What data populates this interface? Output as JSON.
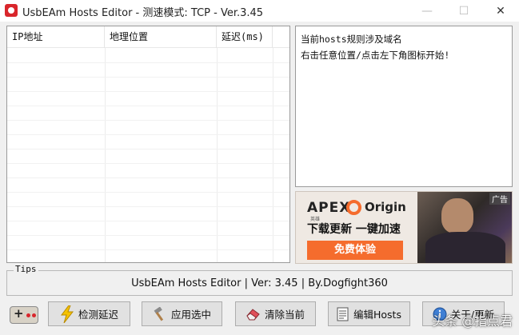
{
  "window": {
    "title": "UsbEAm Hosts Editor - 测速模式: TCP - Ver.3.45",
    "minimize_glyph": "—",
    "maximize_glyph": "☐",
    "close_glyph": "✕"
  },
  "table": {
    "columns": [
      "IP地址",
      "地理位置",
      "延迟(ms)",
      ""
    ],
    "rows": []
  },
  "info": {
    "lines": [
      "当前hosts规则涉及域名",
      "右击任意位置/点击左下角图标开始!"
    ]
  },
  "ad": {
    "tag": "广告",
    "brand": "APEX",
    "brand_sub": "英雄",
    "partner": "Origin",
    "headline": "下载更新 一键加速",
    "cta": "免费体验"
  },
  "tips": {
    "label": "Tips",
    "text": "UsbEAm Hosts Editor | Ver: 3.45 | By.Dogfight360"
  },
  "toolbar": {
    "buttons": [
      {
        "label": "检测延迟",
        "icon": "lightning-icon"
      },
      {
        "label": "应用选中",
        "icon": "hammer-icon"
      },
      {
        "label": "清除当前",
        "icon": "eraser-icon"
      },
      {
        "label": "编辑Hosts",
        "icon": "document-icon"
      },
      {
        "label": "关于/更新",
        "icon": "info-icon"
      }
    ]
  },
  "watermark": "头条 @指点君",
  "colors": {
    "accent": "#f56c2d",
    "app_icon": "#d9262c"
  }
}
